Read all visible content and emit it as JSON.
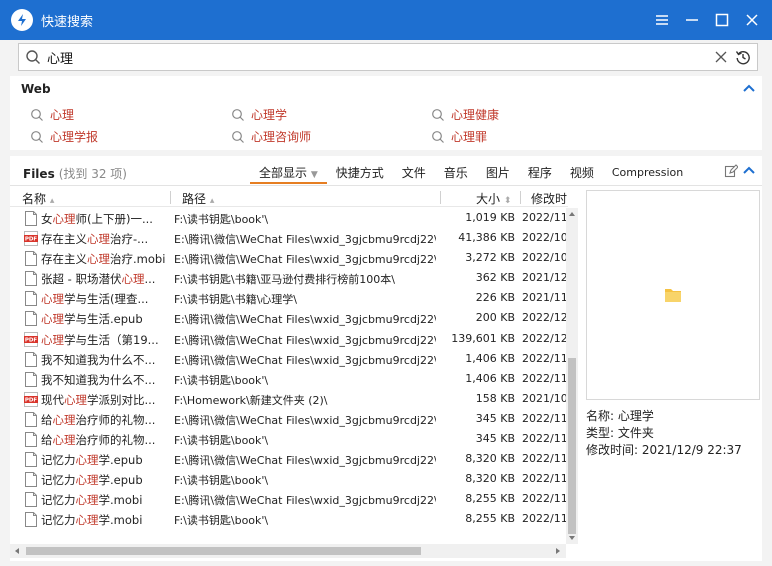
{
  "window": {
    "title": "快速搜索"
  },
  "search": {
    "value": "心理"
  },
  "web": {
    "title": "Web",
    "items": [
      "心理",
      "心理学",
      "心理健康",
      "心理学报",
      "心理咨询师",
      "心理罪"
    ]
  },
  "files": {
    "title": "Files",
    "count_text": "(找到 32 项)",
    "tabs": [
      "全部显示",
      "快捷方式",
      "文件",
      "音乐",
      "图片",
      "程序",
      "视频",
      "Compression"
    ],
    "columns": {
      "name": "名称",
      "path": "路径",
      "size": "大小",
      "modified": "修改时"
    },
    "rows": [
      {
        "icon": "doc",
        "pre": "女",
        "hl": "心理",
        "post": "师(上下册)一...",
        "path": "F:\\读书钥匙\\book'\\",
        "size": "1,019 KB",
        "date": "2022/11"
      },
      {
        "icon": "pdf",
        "pre": "存在主义",
        "hl": "心理",
        "post": "治疗-...",
        "path": "E:\\腾讯\\微信\\WeChat Files\\wxid_3gjcbmu9rcdj22\\F...",
        "size": "41,386 KB",
        "date": "2022/10"
      },
      {
        "icon": "doc",
        "pre": "存在主义",
        "hl": "心理",
        "post": "治疗.mobi",
        "path": "E:\\腾讯\\微信\\WeChat Files\\wxid_3gjcbmu9rcdj22\\F...",
        "size": "3,272 KB",
        "date": "2022/10"
      },
      {
        "icon": "doc",
        "pre": "张超 - 职场潜伏",
        "hl": "心理",
        "post": "...",
        "path": "F:\\读书钥匙\\书籍\\亚马逊付费排行榜前100本\\",
        "size": "362 KB",
        "date": "2021/12"
      },
      {
        "icon": "doc",
        "pre": "",
        "hl": "心理",
        "post": "学与生活(理查...",
        "path": "F:\\读书钥匙\\书籍\\心理学\\",
        "size": "226 KB",
        "date": "2021/11"
      },
      {
        "icon": "doc",
        "pre": "",
        "hl": "心理",
        "post": "学与生活.epub",
        "path": "E:\\腾讯\\微信\\WeChat Files\\wxid_3gjcbmu9rcdj22\\F...",
        "size": "200 KB",
        "date": "2022/12"
      },
      {
        "icon": "pdf",
        "pre": "",
        "hl": "心理",
        "post": "学与生活（第19...",
        "path": "E:\\腾讯\\微信\\WeChat Files\\wxid_3gjcbmu9rcdj22\\F...",
        "size": "139,601 KB",
        "date": "2022/12"
      },
      {
        "icon": "doc",
        "pre": "我不知道我为什么不...",
        "hl": "",
        "post": "",
        "path": "E:\\腾讯\\微信\\WeChat Files\\wxid_3gjcbmu9rcdj22\\F...",
        "size": "1,406 KB",
        "date": "2022/11"
      },
      {
        "icon": "doc",
        "pre": "我不知道我为什么不...",
        "hl": "",
        "post": "",
        "path": "F:\\读书钥匙\\book'\\",
        "size": "1,406 KB",
        "date": "2022/11"
      },
      {
        "icon": "pdf",
        "pre": "现代",
        "hl": "心理",
        "post": "学派别对比...",
        "path": "F:\\Homework\\新建文件夹 (2)\\",
        "size": "158 KB",
        "date": "2021/10"
      },
      {
        "icon": "doc",
        "pre": "给",
        "hl": "心理",
        "post": "治疗师的礼物...",
        "path": "E:\\腾讯\\微信\\WeChat Files\\wxid_3gjcbmu9rcdj22\\F...",
        "size": "345 KB",
        "date": "2022/11"
      },
      {
        "icon": "doc",
        "pre": "给",
        "hl": "心理",
        "post": "治疗师的礼物...",
        "path": "F:\\读书钥匙\\book'\\",
        "size": "345 KB",
        "date": "2022/11"
      },
      {
        "icon": "doc",
        "pre": "记忆力",
        "hl": "心理",
        "post": "学.epub",
        "path": "E:\\腾讯\\微信\\WeChat Files\\wxid_3gjcbmu9rcdj22\\F...",
        "size": "8,320 KB",
        "date": "2022/11"
      },
      {
        "icon": "doc",
        "pre": "记忆力",
        "hl": "心理",
        "post": "学.epub",
        "path": "F:\\读书钥匙\\book'\\",
        "size": "8,320 KB",
        "date": "2022/11"
      },
      {
        "icon": "doc",
        "pre": "记忆力",
        "hl": "心理",
        "post": "学.mobi",
        "path": "E:\\腾讯\\微信\\WeChat Files\\wxid_3gjcbmu9rcdj22\\F...",
        "size": "8,255 KB",
        "date": "2022/11"
      },
      {
        "icon": "doc",
        "pre": "记忆力",
        "hl": "心理",
        "post": "学.mobi",
        "path": "F:\\读书钥匙\\book'\\",
        "size": "8,255 KB",
        "date": "2022/11"
      }
    ]
  },
  "preview": {
    "name_label": "名称:",
    "name_value": "心理学",
    "type_label": "类型:",
    "type_value": "文件夹",
    "modified_label": "修改时间:",
    "modified_value": "2021/12/9 22:37"
  },
  "colors": {
    "titlebar": "#1e6fd0",
    "highlight": "#c0392b",
    "active_tab": "#e67e22",
    "pdf": "#d9342b",
    "folder": "#f5c242"
  }
}
